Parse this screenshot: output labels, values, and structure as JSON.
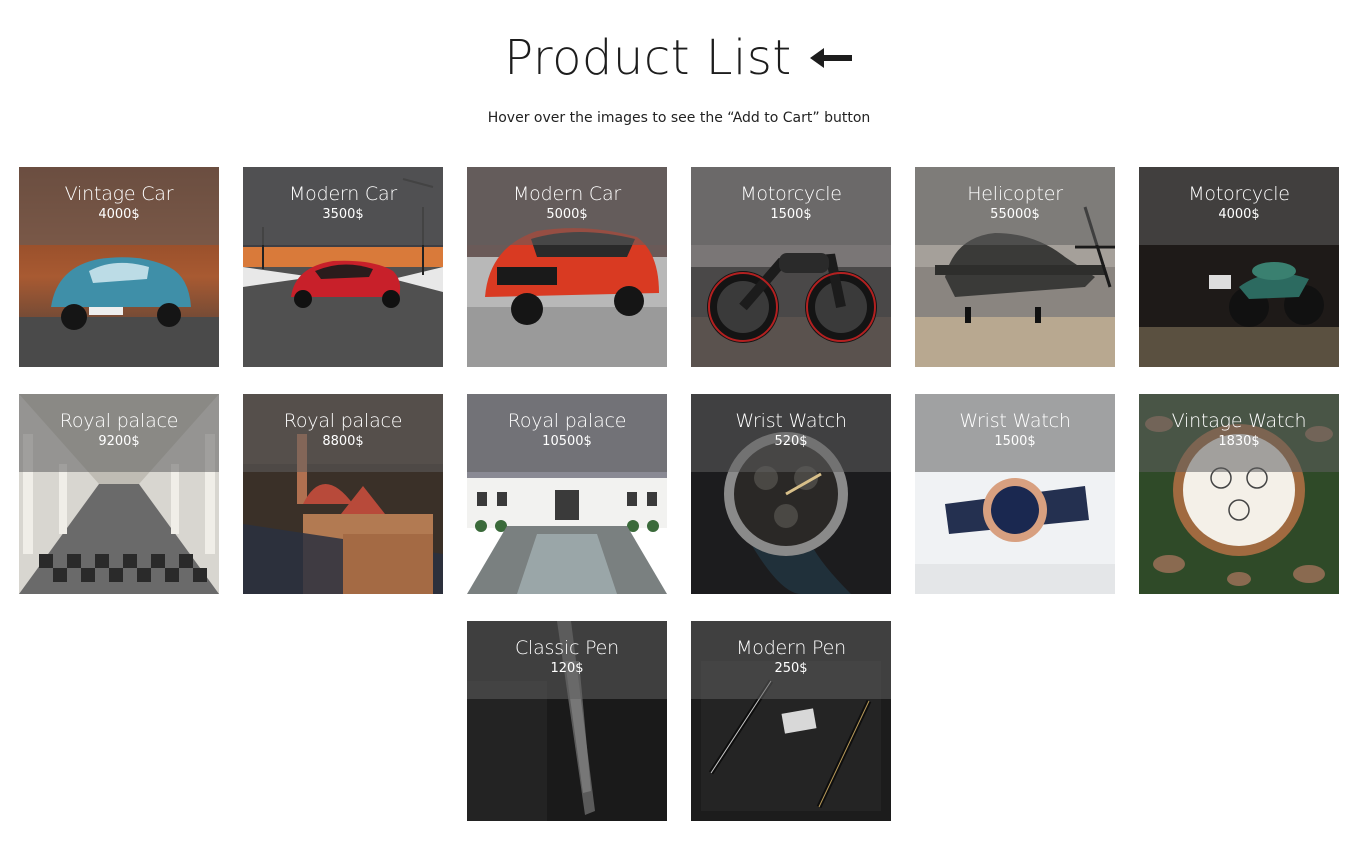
{
  "header": {
    "title": "Product List",
    "back_icon": "left-arrow-icon",
    "subtitle": "Hover over the images to see the “Add to Cart” button"
  },
  "products": [
    {
      "name": "Vintage Car",
      "price": "4000$",
      "image": "vintage-car"
    },
    {
      "name": "Modern Car",
      "price": "3500$",
      "image": "modern-car-red-sports"
    },
    {
      "name": "Modern Car",
      "price": "5000$",
      "image": "modern-car-red-suv"
    },
    {
      "name": "Motorcycle",
      "price": "1500$",
      "image": "motorcycle-black"
    },
    {
      "name": "Helicopter",
      "price": "55000$",
      "image": "aircraft"
    },
    {
      "name": "Motorcycle",
      "price": "4000$",
      "image": "motorcycle-green"
    },
    {
      "name": "Royal palace",
      "price": "9200$",
      "image": "palace-hall"
    },
    {
      "name": "Royal palace",
      "price": "8800$",
      "image": "palace-towers"
    },
    {
      "name": "Royal palace",
      "price": "10500$",
      "image": "palace-pool"
    },
    {
      "name": "Wrist Watch",
      "price": "520$",
      "image": "watch-steel"
    },
    {
      "name": "Wrist Watch",
      "price": "1500$",
      "image": "watch-gold"
    },
    {
      "name": "Vintage Watch",
      "price": "1830$",
      "image": "pocket-watch"
    },
    {
      "name": "Classic Pen",
      "price": "120$",
      "image": "pen-classic"
    },
    {
      "name": "Modern Pen",
      "price": "250$",
      "image": "pen-modern"
    }
  ]
}
